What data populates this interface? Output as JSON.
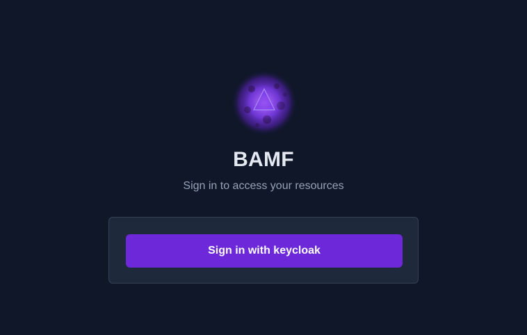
{
  "app": {
    "title": "BAMF",
    "subtitle": "Sign in to access your resources"
  },
  "login": {
    "button_label": "Sign in with keycloak"
  },
  "icons": {
    "logo": "triangle-nebula-logo-icon"
  },
  "colors": {
    "background": "#0f1729",
    "card_background": "#1e293b",
    "card_border": "#334155",
    "accent": "#6d28d9",
    "title_text": "#e5e9f2",
    "subtitle_text": "#97a3b6"
  }
}
